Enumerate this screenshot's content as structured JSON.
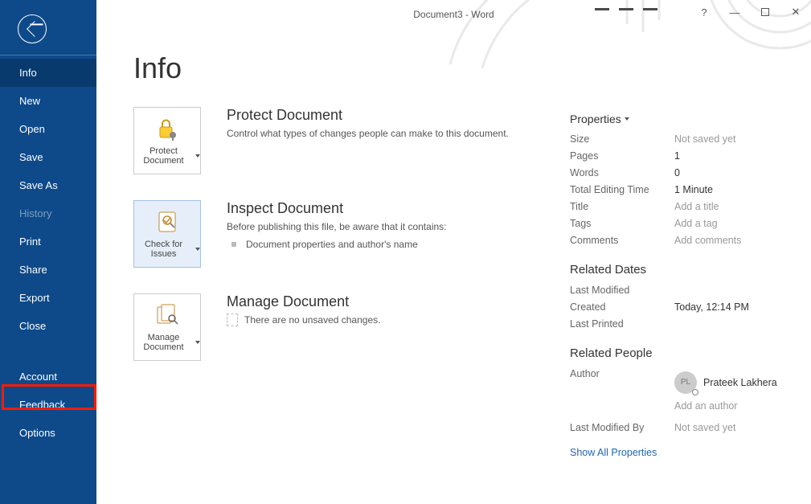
{
  "titlebar": {
    "title": "Document3  -  Word"
  },
  "sidebar": {
    "items": [
      {
        "label": "Info",
        "active": true
      },
      {
        "label": "New"
      },
      {
        "label": "Open"
      },
      {
        "label": "Save"
      },
      {
        "label": "Save As"
      },
      {
        "label": "History",
        "dim": true
      },
      {
        "label": "Print"
      },
      {
        "label": "Share"
      },
      {
        "label": "Export"
      },
      {
        "label": "Close"
      }
    ],
    "bottom_items": [
      {
        "label": "Account"
      },
      {
        "label": "Feedback"
      },
      {
        "label": "Options"
      }
    ]
  },
  "page_title": "Info",
  "cards": {
    "protect": {
      "button_label": "Protect Document",
      "title": "Protect Document",
      "desc": "Control what types of changes people can make to this document."
    },
    "inspect": {
      "button_label": "Check for Issues",
      "title": "Inspect Document",
      "desc": "Before publishing this file, be aware that it contains:",
      "bullet1": "Document properties and author's name"
    },
    "manage": {
      "button_label": "Manage Document",
      "title": "Manage Document",
      "no_changes": "There are no unsaved changes."
    }
  },
  "props": {
    "header": "Properties",
    "rows": [
      {
        "k": "Size",
        "v": "Not saved yet",
        "ph": true
      },
      {
        "k": "Pages",
        "v": "1"
      },
      {
        "k": "Words",
        "v": "0"
      },
      {
        "k": "Total Editing Time",
        "v": "1 Minute"
      },
      {
        "k": "Title",
        "v": "Add a title",
        "ph": true,
        "editable": true
      },
      {
        "k": "Tags",
        "v": "Add a tag",
        "ph": true,
        "editable": true
      },
      {
        "k": "Comments",
        "v": "Add comments",
        "ph": true,
        "editable": true
      }
    ],
    "dates_title": "Related Dates",
    "dates": [
      {
        "k": "Last Modified",
        "v": ""
      },
      {
        "k": "Created",
        "v": "Today, 12:14 PM"
      },
      {
        "k": "Last Printed",
        "v": ""
      }
    ],
    "people_title": "Related People",
    "author_label": "Author",
    "author_initials": "PL",
    "author_name": "Prateek Lakhera",
    "add_author": "Add an author",
    "last_mod_by_label": "Last Modified By",
    "last_mod_by_value": "Not saved yet",
    "show_all": "Show All Properties"
  }
}
